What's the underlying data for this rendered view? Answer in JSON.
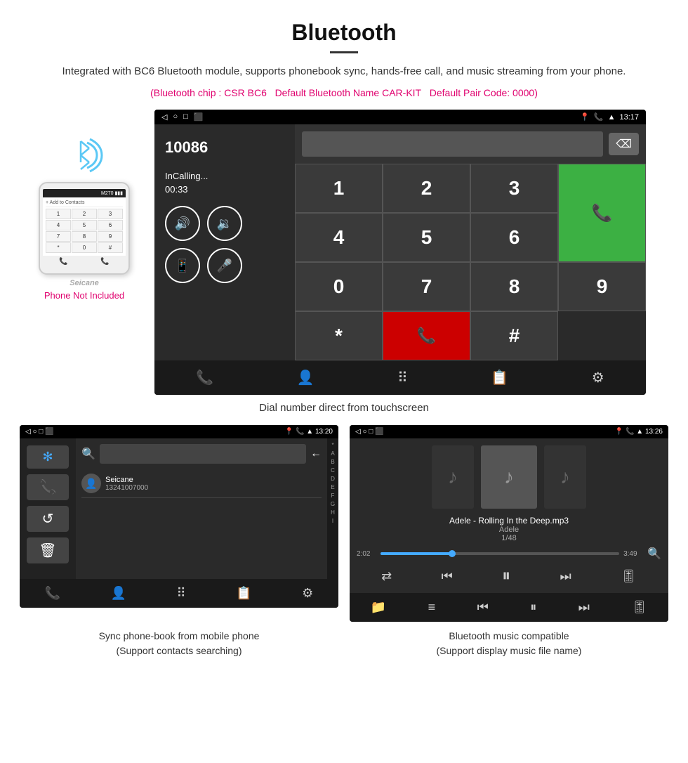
{
  "header": {
    "title": "Bluetooth",
    "description": "Integrated with BC6 Bluetooth module, supports phonebook sync, hands-free call, and music streaming from your phone.",
    "spec1": "(Bluetooth chip : CSR BC6",
    "spec2": "Default Bluetooth Name CAR-KIT",
    "spec3": "Default Pair Code: 0000)"
  },
  "phone_mock": {
    "not_included": "Phone Not Included",
    "watermark": "Seicane",
    "dialpad_keys": [
      "1",
      "2",
      "3",
      "4",
      "5",
      "6",
      "7",
      "8",
      "9",
      "*",
      "0",
      "#"
    ]
  },
  "car_screen": {
    "status_bar": {
      "left_icons": [
        "◁",
        "○",
        "□",
        "⬛"
      ],
      "right_icons": [
        "📍",
        "📞",
        "▲",
        "13:17"
      ]
    },
    "number": "10086",
    "calling_status": "InCalling...",
    "calling_time": "00:33",
    "dialpad_keys": [
      "1",
      "2",
      "3",
      "*",
      "4",
      "5",
      "6",
      "0",
      "7",
      "8",
      "9",
      "#"
    ],
    "call_button_label": "📞",
    "end_button_label": "📞",
    "bottom_icons": [
      "📞",
      "👤",
      "⠿",
      "📋",
      "⚙"
    ]
  },
  "caption_main": "Dial number direct from touchscreen",
  "phonebook_screen": {
    "status_bar": {
      "left_icons": [
        "◁",
        "○",
        "□",
        "⬛"
      ],
      "right_icons": [
        "📍",
        "📞",
        "▲",
        "13:20"
      ]
    },
    "contact_name": "Seicane",
    "contact_number": "13241007000",
    "search_placeholder": "Search",
    "alphabet": [
      "*",
      "A",
      "B",
      "C",
      "D",
      "E",
      "F",
      "G",
      "H",
      "I"
    ],
    "bottom_icons": [
      "📞",
      "👤",
      "⠿",
      "📋",
      "⚙"
    ]
  },
  "music_screen": {
    "status_bar": {
      "left_icons": [
        "◁",
        "○",
        "□",
        "⬛"
      ],
      "right_icons": [
        "📍",
        "📞",
        "▲",
        "13:26"
      ]
    },
    "song_title": "Adele - Rolling In the Deep.mp3",
    "artist": "Adele",
    "track_info": "1/48",
    "time_current": "2:02",
    "time_total": "3:49",
    "progress_percent": 30,
    "bottom_icons": [
      "📁",
      "≡",
      "⏮",
      "⏸",
      "⏭",
      "🎚"
    ]
  },
  "caption_phonebook": "Sync phone-book from mobile phone\n(Support contacts searching)",
  "caption_music": "Bluetooth music compatible\n(Support display music file name)"
}
